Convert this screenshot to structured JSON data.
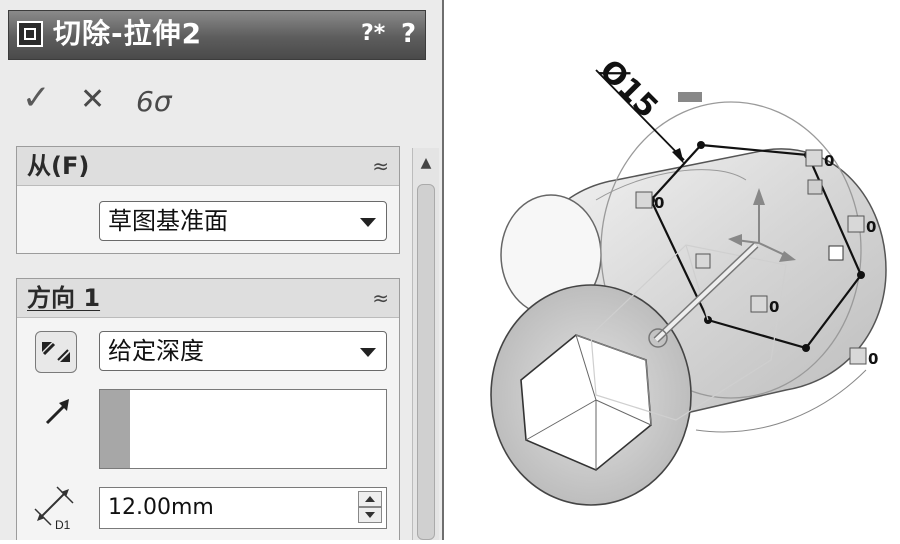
{
  "feature": {
    "title": "切除-拉伸2",
    "help_icon_1": "?*",
    "help_icon_2": "?"
  },
  "toolbar": {
    "ok_icon": "✓",
    "cancel_icon": "✕",
    "preview_icon": "6σ"
  },
  "from_group": {
    "header": "从(F)",
    "collapse_icon": "≈",
    "start_condition": "草图基准面"
  },
  "direction1_group": {
    "header": "方向 1",
    "collapse_icon": "≈",
    "end_condition": "给定深度",
    "depth_value": "12.00mm",
    "depth_label": "D1"
  },
  "viewport": {
    "diameter_dimension": "Ø15",
    "relation_label": "0"
  }
}
